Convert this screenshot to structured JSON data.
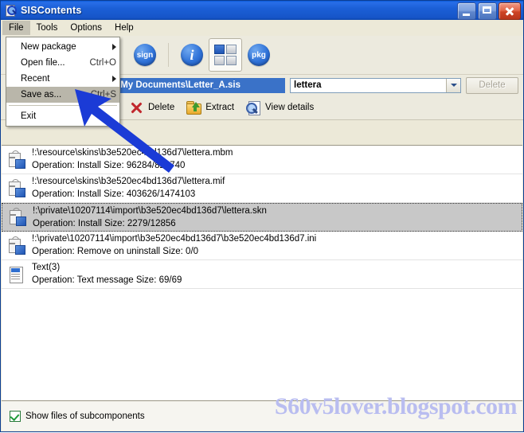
{
  "window": {
    "title": "SISContents",
    "icon": "sis-document-icon",
    "controls": {
      "minimize": "minimize-button",
      "maximize": "maximize-button",
      "close": "close-button"
    }
  },
  "menubar": {
    "items": [
      {
        "label": "File",
        "open": true
      },
      {
        "label": "Tools",
        "open": false
      },
      {
        "label": "Options",
        "open": false
      },
      {
        "label": "Help",
        "open": false
      }
    ]
  },
  "file_menu": {
    "items": [
      {
        "label": "New package",
        "accel": "",
        "submenu": true,
        "highlighted": false
      },
      {
        "label": "Open file...",
        "accel": "Ctrl+O",
        "submenu": false,
        "highlighted": false
      },
      {
        "label": "Recent",
        "accel": "",
        "submenu": true,
        "highlighted": false
      },
      {
        "label": "Save as...",
        "accel": "Ctrl+S",
        "submenu": false,
        "highlighted": true
      },
      {
        "label": "Exit",
        "accel": "",
        "submenu": false,
        "highlighted": false
      }
    ]
  },
  "toolbar": {
    "dropdown_caret": "chevron-down-icon",
    "buttons": [
      {
        "name": "sign-button",
        "label": "sign"
      },
      {
        "name": "info-button",
        "label": "i"
      },
      {
        "name": "contents-button",
        "label": ""
      },
      {
        "name": "pkg-button",
        "label": "pkg"
      }
    ]
  },
  "pathbar": {
    "path_value": "\\My Documents\\Letter_A.sis",
    "combo_value": "lettera",
    "delete_label": "Delete",
    "delete_enabled": false
  },
  "actionbar": {
    "actions": [
      {
        "name": "delete-action",
        "label": "Delete",
        "icon": "red-x-icon"
      },
      {
        "name": "extract-action",
        "label": "Extract",
        "icon": "folder-extract-icon"
      },
      {
        "name": "view-details-action",
        "label": "View details",
        "icon": "magnifier-page-icon"
      }
    ]
  },
  "list": {
    "rows": [
      {
        "icon": "package-file-icon",
        "title": "!:\\resource\\skins\\b3e520ec4bd136d7\\lettera.mbm",
        "subtitle": "Operation: Install  Size: 96284/829740",
        "selected": false
      },
      {
        "icon": "package-file-icon",
        "title": "!:\\resource\\skins\\b3e520ec4bd136d7\\lettera.mif",
        "subtitle": "Operation: Install  Size: 403626/1474103",
        "selected": false
      },
      {
        "icon": "package-file-icon",
        "title": "!:\\private\\10207114\\import\\b3e520ec4bd136d7\\lettera.skn",
        "subtitle": "Operation: Install  Size: 2279/12856",
        "selected": true
      },
      {
        "icon": "package-file-icon",
        "title": "!:\\private\\10207114\\import\\b3e520ec4bd136d7\\b3e520ec4bd136d7.ini",
        "subtitle": "Operation: Remove on uninstall  Size: 0/0",
        "selected": false
      },
      {
        "icon": "text-message-icon",
        "title": "Text(3)",
        "subtitle": "Operation: Text message  Size: 69/69",
        "selected": false
      }
    ]
  },
  "footer": {
    "checkbox_label": "Show files of subcomponents",
    "checkbox_checked": true
  },
  "watermark": {
    "text": "S60v5lover.blogspot.com",
    "color": "#b9bdf0"
  },
  "annotation": {
    "arrow": "blue-arrow-pointer",
    "color": "#1b3bd6"
  }
}
